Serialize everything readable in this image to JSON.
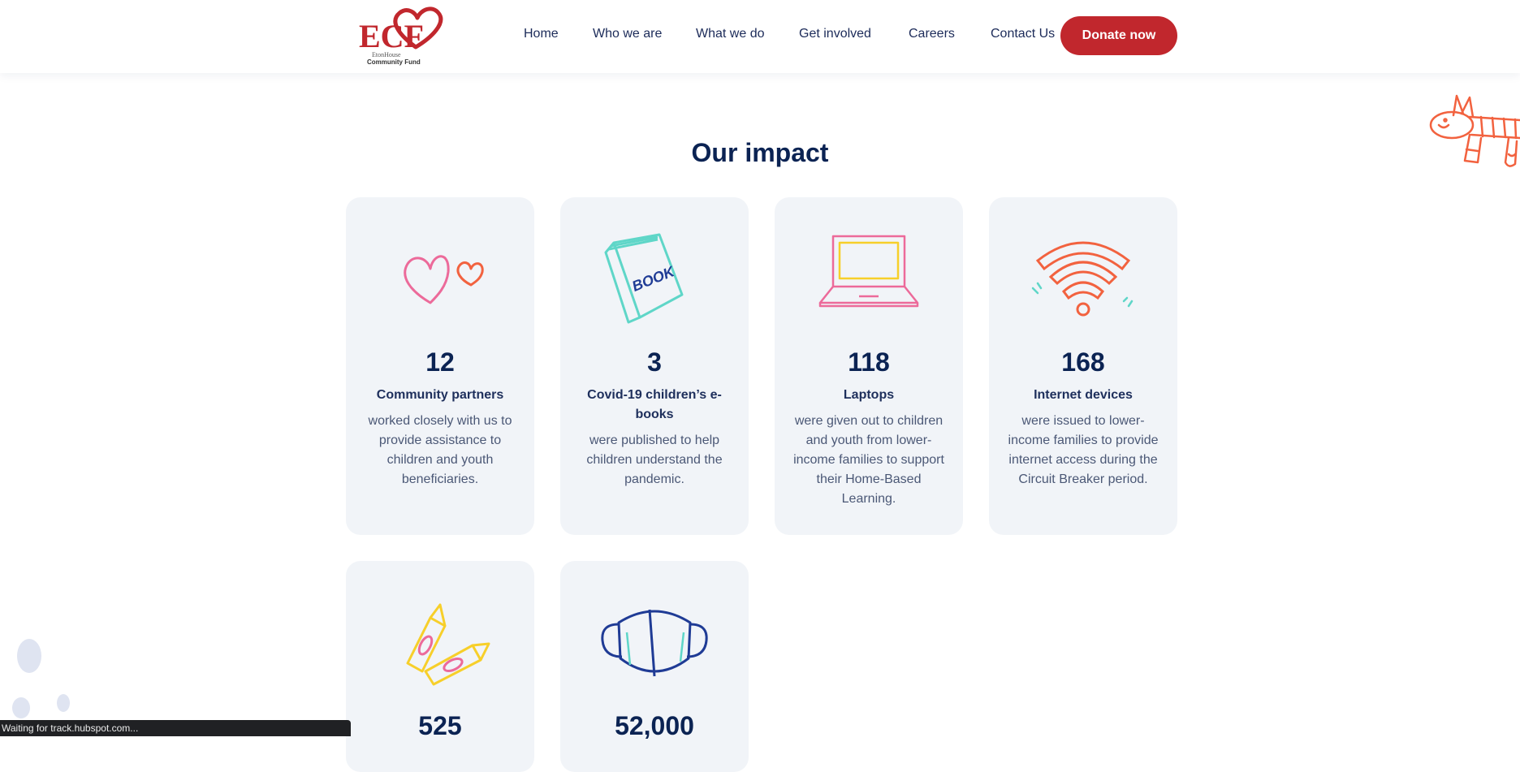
{
  "header": {
    "logo": {
      "main": "ECF",
      "line1": "EtonHouse",
      "line2": "Community Fund",
      "icon": "heart-logo-icon"
    },
    "nav": [
      "Home",
      "Who we are",
      "What we do",
      "Get involved",
      "Careers",
      "Contact Us"
    ],
    "donate_label": "Donate now"
  },
  "impact": {
    "title": "Our impact",
    "cards": [
      {
        "number": "12",
        "label": "Community partners",
        "desc": "worked closely with us to provide assistance to children and youth beneficiaries.",
        "icon": "hearts-icon"
      },
      {
        "number": "3",
        "label": "Covid-19 children’s e-books",
        "desc": "were published to help children understand the pandemic.",
        "icon": "book-icon",
        "icon_text": "BOOK"
      },
      {
        "number": "118",
        "label": "Laptops",
        "desc": "were given out to children and youth from lower-income families to support their Home-Based Learning.",
        "icon": "laptop-icon"
      },
      {
        "number": "168",
        "label": "Internet devices",
        "desc": "were issued to lower-income families to provide internet access during the Circuit Breaker period.",
        "icon": "wifi-icon"
      },
      {
        "number": "525",
        "icon": "crayons-icon"
      },
      {
        "number": "52,000",
        "icon": "face-mask-icon"
      }
    ]
  },
  "status_bar": "Waiting for track.hubspot.com...",
  "colors": {
    "brand_red": "#c1272d",
    "navy": "#0b2353",
    "card_bg": "#f1f4f8",
    "pink": "#ec6a9a",
    "orange": "#f2623f",
    "teal": "#5fd6c8",
    "yellow": "#f7cf2a",
    "blue": "#1f3b95"
  }
}
